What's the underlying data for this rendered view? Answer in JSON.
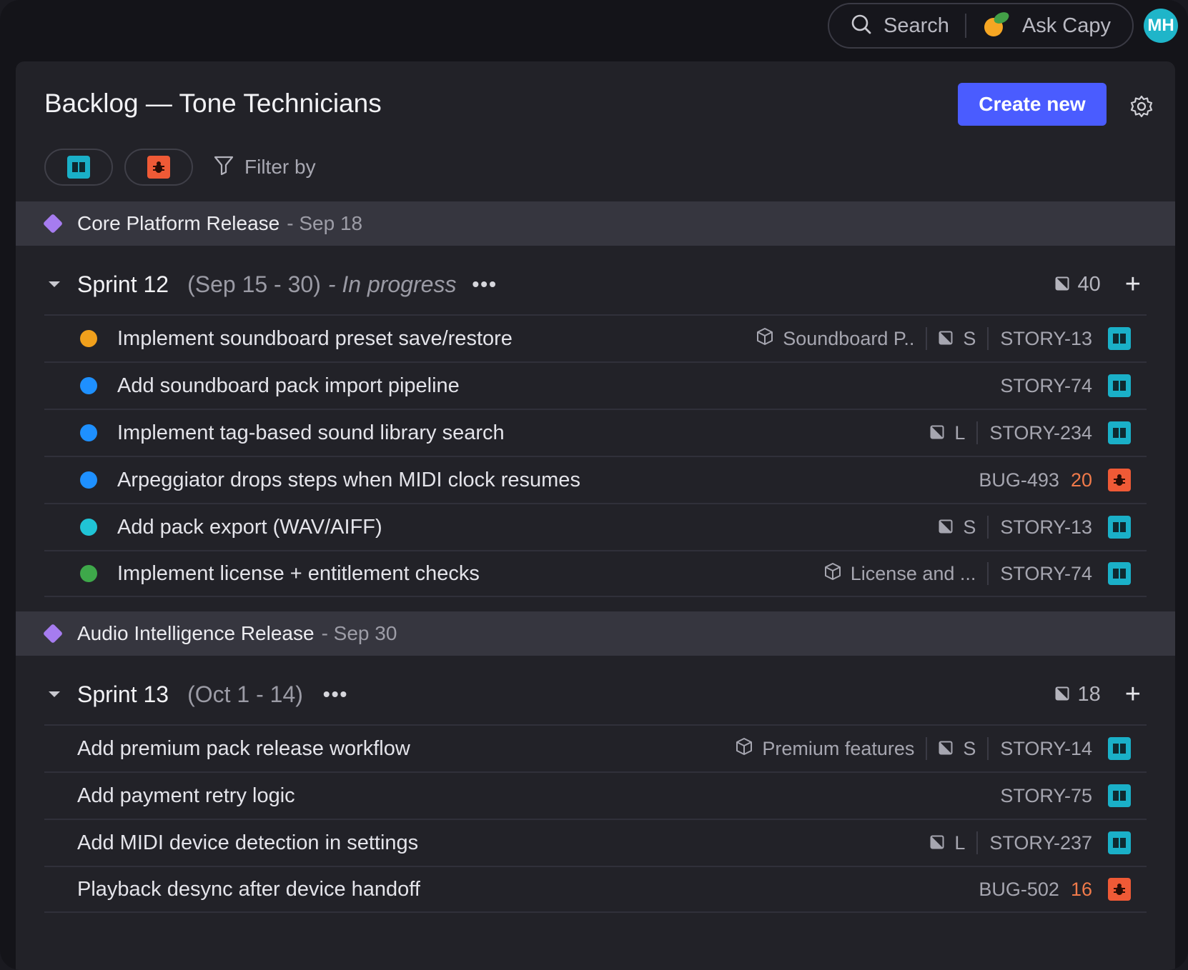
{
  "topbar": {
    "search_label": "Search",
    "ask_label": "Ask Capy",
    "avatar_initials": "MH"
  },
  "page": {
    "title": "Backlog — Tone Technicians",
    "create_label": "Create new",
    "filter_label": "Filter by"
  },
  "colors": {
    "accent": "#4a5cff",
    "story": "#1ab0c8",
    "bug": "#ef5a36",
    "release": "#a67cf0"
  },
  "releases": [
    {
      "name": "Core Platform Release",
      "date": "- Sep 18",
      "sprint": {
        "name": "Sprint 12",
        "dates": "(Sep 15 - 30)",
        "status": "- In progress",
        "points": "40",
        "items": [
          {
            "status_color": "#f0a01c",
            "title": "Implement soundboard preset save/restore",
            "epic": "Soundboard P..",
            "estimate": "S",
            "key": "STORY-13",
            "type": "story"
          },
          {
            "status_color": "#1e90ff",
            "title": "Add soundboard pack import pipeline",
            "key": "STORY-74",
            "type": "story"
          },
          {
            "status_color": "#1e90ff",
            "title": "Implement tag-based sound library search",
            "estimate": "L",
            "key": "STORY-234",
            "type": "story"
          },
          {
            "status_color": "#1e90ff",
            "title": "Arpeggiator drops steps when MIDI clock resumes",
            "key": "BUG-493",
            "priority": "20",
            "type": "bug"
          },
          {
            "status_color": "#20c4d6",
            "title": "Add pack export (WAV/AIFF)",
            "estimate": "S",
            "key": "STORY-13",
            "type": "story"
          },
          {
            "status_color": "#3ea84a",
            "title": "Implement license + entitlement checks",
            "epic": "License and ...",
            "key": "STORY-74",
            "type": "story"
          }
        ]
      }
    },
    {
      "name": "Audio Intelligence Release",
      "date": "- Sep 30",
      "sprint": {
        "name": "Sprint 13",
        "dates": "(Oct 1 - 14)",
        "status": "",
        "points": "18",
        "items": [
          {
            "title": "Add premium pack release workflow",
            "epic": "Premium features",
            "estimate": "S",
            "key": "STORY-14",
            "type": "story"
          },
          {
            "title": "Add payment retry logic",
            "key": "STORY-75",
            "type": "story"
          },
          {
            "title": "Add MIDI device detection in settings",
            "estimate": "L",
            "key": "STORY-237",
            "type": "story"
          },
          {
            "title": "Playback desync after device handoff",
            "key": "BUG-502",
            "priority": "16",
            "type": "bug"
          }
        ]
      }
    }
  ]
}
